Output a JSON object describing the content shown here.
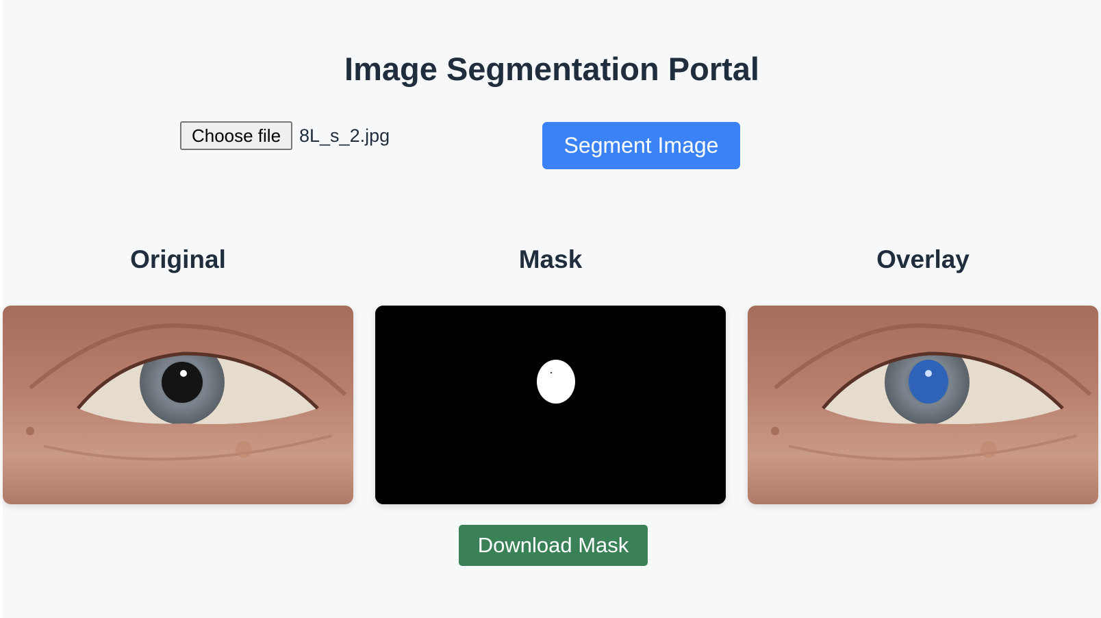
{
  "header": {
    "title": "Image Segmentation Portal"
  },
  "upload": {
    "choose_label": "Choose file",
    "file_name": "8L_s_2.jpg",
    "segment_label": "Segment Image"
  },
  "results": {
    "original_label": "Original",
    "mask_label": "Mask",
    "overlay_label": "Overlay",
    "download_label": "Download Mask"
  },
  "colors": {
    "primary_button": "#3b82f6",
    "download_button": "#3b8157",
    "overlay_tint": "#2f63b8",
    "mask_background": "#000000",
    "mask_foreground": "#ffffff"
  }
}
